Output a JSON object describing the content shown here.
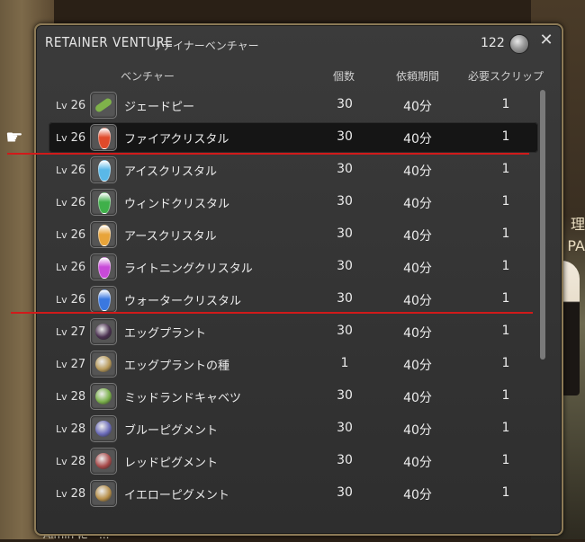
{
  "window": {
    "title_en": "RETAINER VENTURE",
    "title_jp": "リテイナーベンチャー",
    "scrip_count": "122",
    "close_icon": "close-icon"
  },
  "headers": {
    "name": "ベンチャー",
    "qty": "個数",
    "period": "依頼期間",
    "scrip": "必要スクリップ"
  },
  "rows": [
    {
      "lv_label": "Lv",
      "lv": "26",
      "name": "ジェードピー",
      "qty": "30",
      "period": "40分",
      "scrip": "1",
      "icon": "jade-peas-icon",
      "color": "#7fb24a"
    },
    {
      "lv_label": "Lv",
      "lv": "26",
      "name": "ファイアクリスタル",
      "qty": "30",
      "period": "40分",
      "scrip": "1",
      "icon": "fire-crystal-icon",
      "color": "#e04a2a"
    },
    {
      "lv_label": "Lv",
      "lv": "26",
      "name": "アイスクリスタル",
      "qty": "30",
      "period": "40分",
      "scrip": "1",
      "icon": "ice-crystal-icon",
      "color": "#5ab8e8"
    },
    {
      "lv_label": "Lv",
      "lv": "26",
      "name": "ウィンドクリスタル",
      "qty": "30",
      "period": "40分",
      "scrip": "1",
      "icon": "wind-crystal-icon",
      "color": "#3fb04a"
    },
    {
      "lv_label": "Lv",
      "lv": "26",
      "name": "アースクリスタル",
      "qty": "30",
      "period": "40分",
      "scrip": "1",
      "icon": "earth-crystal-icon",
      "color": "#e8a43a"
    },
    {
      "lv_label": "Lv",
      "lv": "26",
      "name": "ライトニングクリスタル",
      "qty": "30",
      "period": "40分",
      "scrip": "1",
      "icon": "lightning-crystal-icon",
      "color": "#c84ad8"
    },
    {
      "lv_label": "Lv",
      "lv": "26",
      "name": "ウォータークリスタル",
      "qty": "30",
      "period": "40分",
      "scrip": "1",
      "icon": "water-crystal-icon",
      "color": "#3a78e0"
    },
    {
      "lv_label": "Lv",
      "lv": "27",
      "name": "エッグプラント",
      "qty": "30",
      "period": "40分",
      "scrip": "1",
      "icon": "eggplant-icon",
      "color": "#4a3050"
    },
    {
      "lv_label": "Lv",
      "lv": "27",
      "name": "エッグプラントの種",
      "qty": "1",
      "period": "40分",
      "scrip": "1",
      "icon": "seed-bag-icon",
      "color": "#b89a5a"
    },
    {
      "lv_label": "Lv",
      "lv": "28",
      "name": "ミッドランドキャベツ",
      "qty": "30",
      "period": "40分",
      "scrip": "1",
      "icon": "cabbage-icon",
      "color": "#7ab04a"
    },
    {
      "lv_label": "Lv",
      "lv": "28",
      "name": "ブルーピグメント",
      "qty": "30",
      "period": "40分",
      "scrip": "1",
      "icon": "blue-pigment-icon",
      "color": "#6a6ab8"
    },
    {
      "lv_label": "Lv",
      "lv": "28",
      "name": "レッドピグメント",
      "qty": "30",
      "period": "40分",
      "scrip": "1",
      "icon": "red-pigment-icon",
      "color": "#a84a4a"
    },
    {
      "lv_label": "Lv",
      "lv": "28",
      "name": "イエローピグメント",
      "qty": "30",
      "period": "40分",
      "scrip": "1",
      "icon": "yellow-pigment-icon",
      "color": "#b8904a"
    }
  ],
  "selected_index": 1,
  "background": {
    "sign_text": "理\nPA",
    "chat_text": "Aimin にー..."
  }
}
